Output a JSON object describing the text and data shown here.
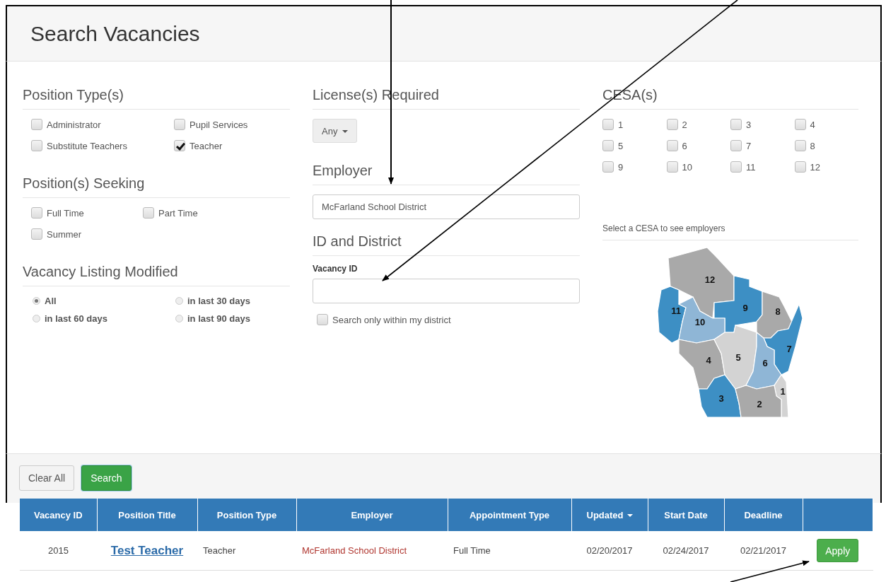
{
  "page_title": "Search Vacancies",
  "position_types": {
    "title": "Position Type(s)",
    "options": [
      {
        "label": "Administrator",
        "checked": false
      },
      {
        "label": "Pupil Services",
        "checked": false
      },
      {
        "label": "Substitute Teachers",
        "checked": false
      },
      {
        "label": "Teacher",
        "checked": true
      }
    ]
  },
  "positions_seeking": {
    "title": "Position(s) Seeking",
    "options": [
      {
        "label": "Full Time",
        "checked": false
      },
      {
        "label": "Part Time",
        "checked": false
      },
      {
        "label": "Summer",
        "checked": false
      }
    ]
  },
  "listing_modified": {
    "title": "Vacancy Listing Modified",
    "options": [
      {
        "label": "All",
        "selected": true
      },
      {
        "label": "in last 30 days",
        "selected": false
      },
      {
        "label": "in last 60 days",
        "selected": false
      },
      {
        "label": "in last 90 days",
        "selected": false
      }
    ]
  },
  "licenses": {
    "title": "License(s) Required",
    "dropdown": "Any"
  },
  "employer": {
    "title": "Employer",
    "value": "McFarland School District"
  },
  "id_and_district": {
    "title": "ID and District",
    "vacancy_id_label": "Vacancy ID",
    "district_only": {
      "label": "Search only within my district",
      "checked": false
    }
  },
  "cesas": {
    "title": "CESA(s)",
    "options": [
      {
        "label": "1",
        "checked": false
      },
      {
        "label": "2",
        "checked": false
      },
      {
        "label": "3",
        "checked": false
      },
      {
        "label": "4",
        "checked": false
      },
      {
        "label": "5",
        "checked": false
      },
      {
        "label": "6",
        "checked": false
      },
      {
        "label": "7",
        "checked": false
      },
      {
        "label": "8",
        "checked": false
      },
      {
        "label": "9",
        "checked": false
      },
      {
        "label": "10",
        "checked": false
      },
      {
        "label": "11",
        "checked": false
      },
      {
        "label": "12",
        "checked": false
      }
    ],
    "map_title": "Select a CESA to see employers",
    "map_regions": [
      {
        "label": "12",
        "color": "#a9a9a9"
      },
      {
        "label": "11",
        "color": "#3d8fc4"
      },
      {
        "label": "9",
        "color": "#3d8fc4"
      },
      {
        "label": "8",
        "color": "#a9a9a9"
      },
      {
        "label": "10",
        "color": "#8fb6d6"
      },
      {
        "label": "7",
        "color": "#3d8fc4"
      },
      {
        "label": "4",
        "color": "#a9a9a9"
      },
      {
        "label": "5",
        "color": "#d3d3d3"
      },
      {
        "label": "6",
        "color": "#8fb6d6"
      },
      {
        "label": "3",
        "color": "#3d8fc4"
      },
      {
        "label": "1",
        "color": "#d3d3d3"
      },
      {
        "label": "2",
        "color": "#a9a9a9"
      }
    ]
  },
  "buttons": [
    {
      "label": "Clear All",
      "kind": "default"
    },
    {
      "label": "Search",
      "kind": "primary"
    }
  ],
  "table": {
    "columns": [
      {
        "label": "Vacancy ID",
        "sorted": false
      },
      {
        "label": "Position Title",
        "sorted": false
      },
      {
        "label": "Position Type",
        "sorted": false
      },
      {
        "label": "Employer",
        "sorted": false
      },
      {
        "label": "Appointment Type",
        "sorted": false
      },
      {
        "label": "Updated",
        "sorted": true
      },
      {
        "label": "Start Date",
        "sorted": false
      },
      {
        "label": "Deadline",
        "sorted": false
      }
    ],
    "rows": [
      {
        "vacancy_id": "2015",
        "position_title": "Test Teacher",
        "position_type": "Teacher",
        "employer": "McFarland School District",
        "appointment_type": "Full Time",
        "updated": "02/20/2017",
        "start_date": "02/24/2017",
        "deadline": "02/21/2017",
        "action": "Apply"
      }
    ]
  }
}
